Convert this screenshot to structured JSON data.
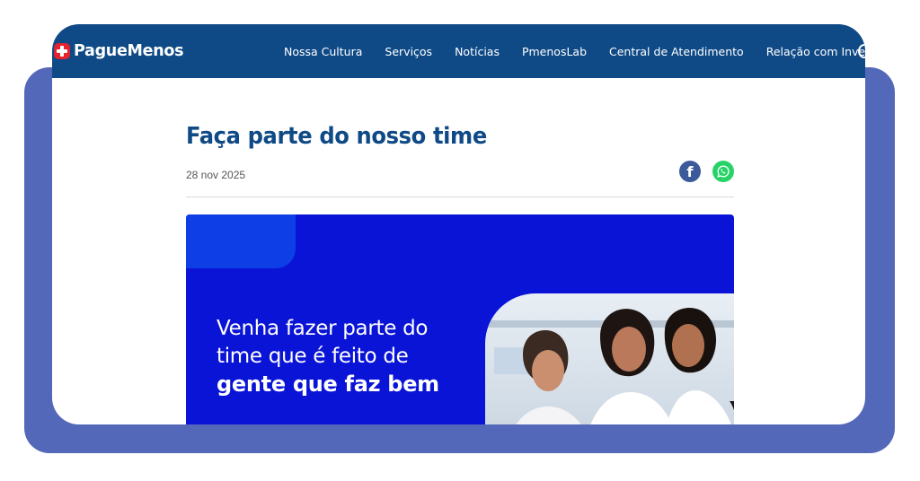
{
  "brand": {
    "name": "PagueMenos",
    "accent": "#0f4a86",
    "cross_color": "#e4232f"
  },
  "nav": {
    "items": [
      {
        "label": "Nossa Cultura"
      },
      {
        "label": "Serviços"
      },
      {
        "label": "Notícias"
      },
      {
        "label": "PmenosLab"
      },
      {
        "label": "Central de Atendimento"
      },
      {
        "label": "Relação com Investidores"
      }
    ],
    "search_icon": "search-icon"
  },
  "article": {
    "title": "Faça parte do nosso time",
    "date": "28 nov 2025",
    "share": {
      "facebook_glyph": "f",
      "whatsapp_icon": "whatsapp-icon"
    }
  },
  "banner": {
    "line1": "Venha fazer parte do",
    "line2": "time que é feito de",
    "line3": "gente que faz bem",
    "background": "#0a14d6"
  }
}
